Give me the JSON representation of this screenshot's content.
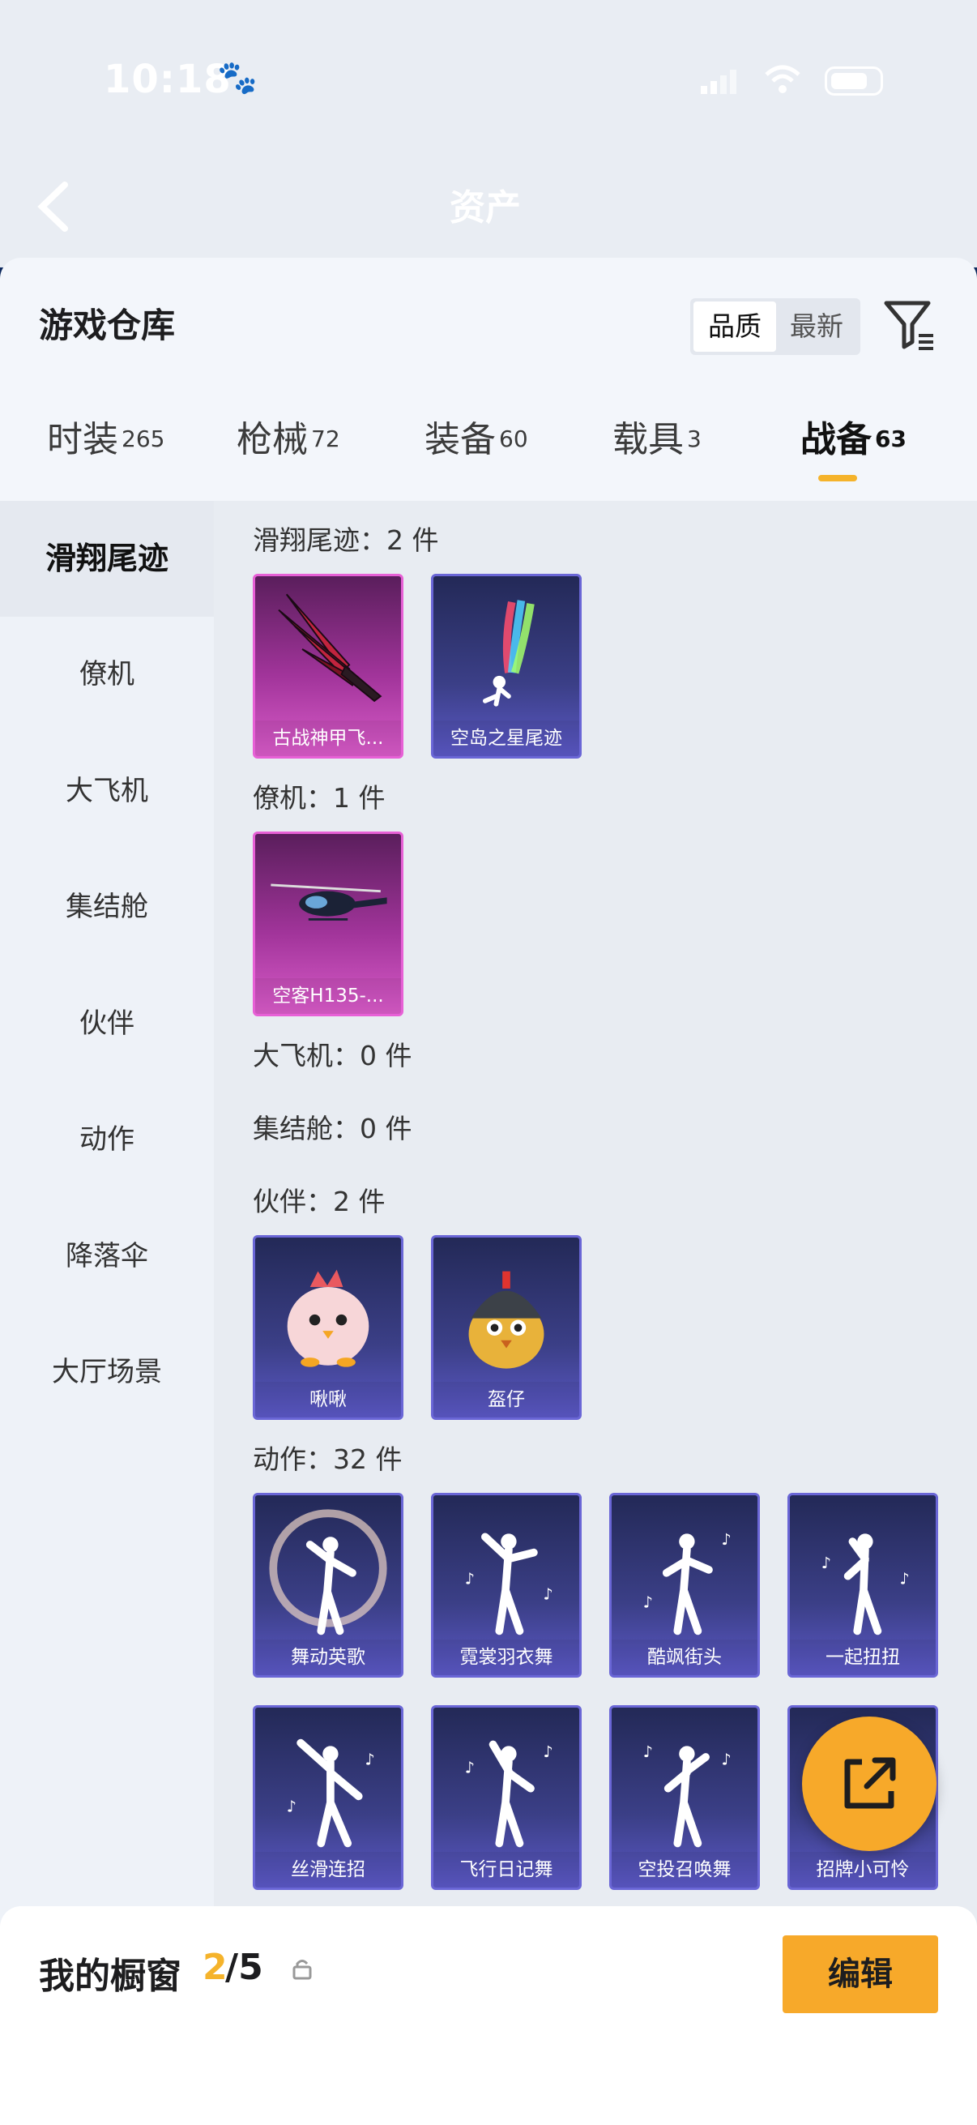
{
  "status": {
    "time": "10:18"
  },
  "nav": {
    "title": "资产"
  },
  "header": {
    "title": "游戏仓库",
    "sort_quality": "品质",
    "sort_new": "最新"
  },
  "tabs": [
    {
      "label": "时装",
      "count": "265",
      "active": false
    },
    {
      "label": "枪械",
      "count": "72",
      "active": false
    },
    {
      "label": "装备",
      "count": "60",
      "active": false
    },
    {
      "label": "载具",
      "count": "3",
      "active": false
    },
    {
      "label": "战备",
      "count": "63",
      "active": true
    }
  ],
  "sidebar": {
    "items": [
      {
        "label": "滑翔尾迹",
        "active": true
      },
      {
        "label": "僚机",
        "active": false
      },
      {
        "label": "大飞机",
        "active": false
      },
      {
        "label": "集结舱",
        "active": false
      },
      {
        "label": "伙伴",
        "active": false
      },
      {
        "label": "动作",
        "active": false
      },
      {
        "label": "降落伞",
        "active": false
      },
      {
        "label": "大厅场景",
        "active": false
      }
    ]
  },
  "sections": [
    {
      "label": "滑翔尾迹：2 件",
      "items": [
        {
          "name": "古战神甲飞...",
          "rarity": "pink",
          "icon": "wing-trail-icon"
        },
        {
          "name": "空岛之星尾迹",
          "rarity": "blue",
          "icon": "star-trail-icon"
        }
      ]
    },
    {
      "label": "僚机：1 件",
      "items": [
        {
          "name": "空客H135-...",
          "rarity": "pink",
          "icon": "helicopter-icon"
        }
      ]
    },
    {
      "label": "大飞机：0 件",
      "items": []
    },
    {
      "label": "集结舱：0 件",
      "items": []
    },
    {
      "label": "伙伴：2 件",
      "items": [
        {
          "name": "啾啾",
          "rarity": "blue",
          "icon": "chick-icon"
        },
        {
          "name": "盔仔",
          "rarity": "blue",
          "icon": "helmet-chick-icon"
        }
      ]
    },
    {
      "label": "动作：32 件",
      "items": [
        {
          "name": "舞动英歌",
          "rarity": "blue",
          "icon": "dance-icon"
        },
        {
          "name": "霓裳羽衣舞",
          "rarity": "blue",
          "icon": "dance-icon"
        },
        {
          "name": "酷飒街头",
          "rarity": "blue",
          "icon": "dance-icon"
        },
        {
          "name": "一起扭扭",
          "rarity": "blue",
          "icon": "dance-icon"
        },
        {
          "name": "丝滑连招",
          "rarity": "blue",
          "icon": "dance-icon"
        },
        {
          "name": "飞行日记舞",
          "rarity": "blue",
          "icon": "dance-icon"
        },
        {
          "name": "空投召唤舞",
          "rarity": "blue",
          "icon": "dance-icon"
        },
        {
          "name": "招牌小可怜",
          "rarity": "blue",
          "icon": "dance-icon"
        }
      ]
    }
  ],
  "showcase": {
    "label": "我的橱窗",
    "current": "2",
    "max": "/5",
    "edit_label": "编辑"
  },
  "colors": {
    "accent": "#f5b32b",
    "pink_card": "#d85bc8",
    "blue_card": "#5b58c5"
  }
}
